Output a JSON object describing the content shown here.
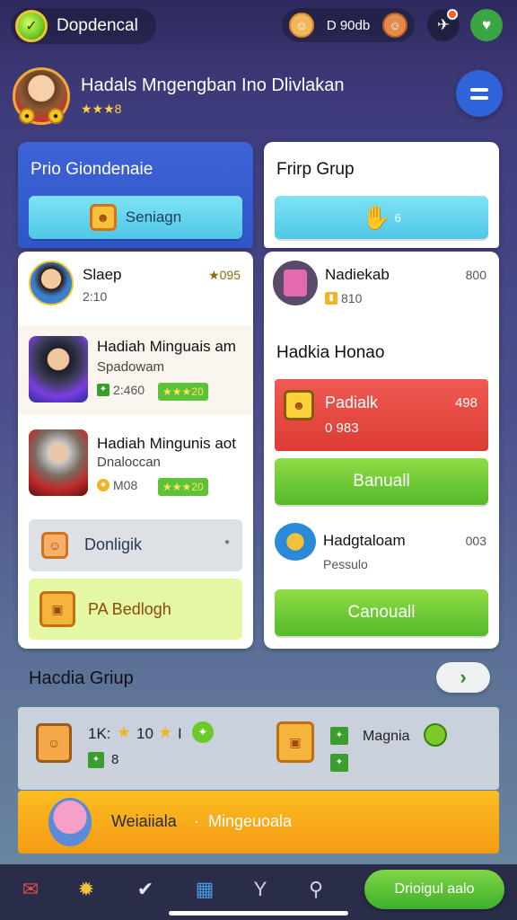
{
  "header": {
    "app_title": "Dopdencal",
    "coin_value": "D 90db",
    "colors": {
      "accent_green": "#55b92a",
      "accent_blue": "#2f55c8"
    }
  },
  "profile": {
    "name": "Hadals Mngengban Ino Dlivlakan",
    "stars": "★★★8"
  },
  "left_panel": {
    "heading": "Prio Giondenaie",
    "button_label": "Seniagn",
    "items": [
      {
        "title": "Slaep",
        "score": "★095",
        "meta": "2:10"
      },
      {
        "title": "Hadiah Minguais am",
        "subtitle": "Spadowam",
        "tag_left": "2:460",
        "tag_right": "★★★20"
      },
      {
        "title": "Hadiah Mingunis aot",
        "subtitle": "Dnaloccan",
        "tag_left": "M08",
        "tag_right": "★★★20"
      }
    ],
    "option_gray": "Donligik",
    "option_lime": "PA Bedlogh"
  },
  "right_panel": {
    "heading": "Frirp Grup",
    "top_button_label": "6",
    "first_item": {
      "title": "Nadiekab",
      "value": "800",
      "meta": "810"
    },
    "section_label": "Hadkia Honao",
    "red_card": {
      "title": "Padialk",
      "value": "498",
      "meta": "0 983"
    },
    "green_button_1": "Banuall",
    "second_item": {
      "title": "Hadgtaloam",
      "value": "003",
      "subtitle": "Pessulo"
    },
    "green_button_2": "Canouall"
  },
  "group": {
    "title": "Hacdia Griup",
    "stat_left": "1K:",
    "stat_mid": "10",
    "stat_tail": "I",
    "stat_small": "8",
    "right_label": "Magnia"
  },
  "banner": {
    "text_a": "Weiaiiala",
    "separator": "·",
    "text_b": "Mingeuoala"
  },
  "tabbar": {
    "cta_label": "Drioigul aalo"
  }
}
